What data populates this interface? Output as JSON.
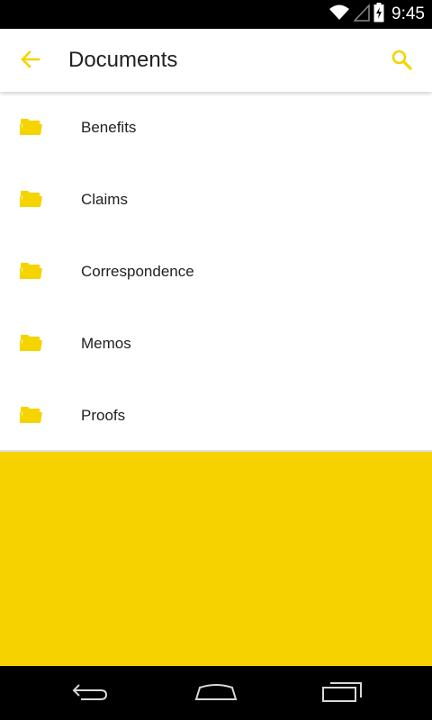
{
  "status_bar": {
    "time": "9:45",
    "icons": [
      "wifi-icon",
      "signal-icon",
      "battery-icon"
    ]
  },
  "app_bar": {
    "title": "Documents",
    "back_icon": "arrow-back-icon",
    "search_icon": "search-icon"
  },
  "list": {
    "items": [
      {
        "label": "Benefits",
        "icon": "folder-icon"
      },
      {
        "label": "Claims",
        "icon": "folder-icon"
      },
      {
        "label": "Correspondence",
        "icon": "folder-icon"
      },
      {
        "label": "Memos",
        "icon": "folder-icon"
      },
      {
        "label": "Proofs",
        "icon": "folder-icon"
      }
    ]
  },
  "nav_bar": {
    "icons": [
      "back-nav-icon",
      "home-nav-icon",
      "recents-nav-icon"
    ]
  },
  "colors": {
    "accent": "#F5D400",
    "footer_panel": "#F6D200",
    "text": "#212121"
  }
}
